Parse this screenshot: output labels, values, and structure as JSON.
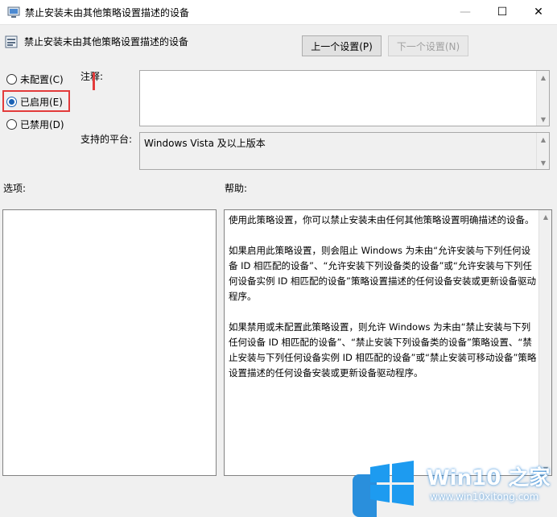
{
  "window": {
    "title": "禁止安装未由其他策略设置描述的设备",
    "minimize_glyph": "—",
    "maximize_glyph": "☐",
    "close_glyph": "✕"
  },
  "header": {
    "title": "禁止安装未由其他策略设置描述的设备",
    "prev_button": "上一个设置(P)",
    "next_button": "下一个设置(N)"
  },
  "state": {
    "options": [
      {
        "label": "未配置(C)",
        "checked": false
      },
      {
        "label": "已启用(E)",
        "checked": true
      },
      {
        "label": "已禁用(D)",
        "checked": false
      }
    ]
  },
  "comment": {
    "label": "注释:",
    "value": ""
  },
  "platform": {
    "label": "支持的平台:",
    "value": "Windows Vista 及以上版本"
  },
  "options_panel": {
    "label": "选项:"
  },
  "help_panel": {
    "label": "帮助:",
    "paragraphs": [
      "使用此策略设置，你可以禁止安装未由任何其他策略设置明确描述的设备。",
      "如果启用此策略设置，则会阻止 Windows 为未由“允许安装与下列任何设备 ID 相匹配的设备”、“允许安装下列设备类的设备”或“允许安装与下列任何设备实例 ID 相匹配的设备”策略设置描述的任何设备安装或更新设备驱动程序。",
      "如果禁用或未配置此策略设置，则允许 Windows 为未由“禁止安装与下列任何设备 ID 相匹配的设备”、“禁止安装下列设备类的设备”策略设置、“禁止安装与下列任何设备实例 ID 相匹配的设备”或“禁止安装可移动设备”策略设置描述的任何设备安装或更新设备驱动程序。"
    ]
  },
  "watermark": {
    "title": "Win10 之家",
    "url": "www.win10xitong.com"
  },
  "colors": {
    "highlight_border": "#e33b3b",
    "radio_accent": "#1b62b5",
    "watermark_blue": "#1d7fd6"
  }
}
